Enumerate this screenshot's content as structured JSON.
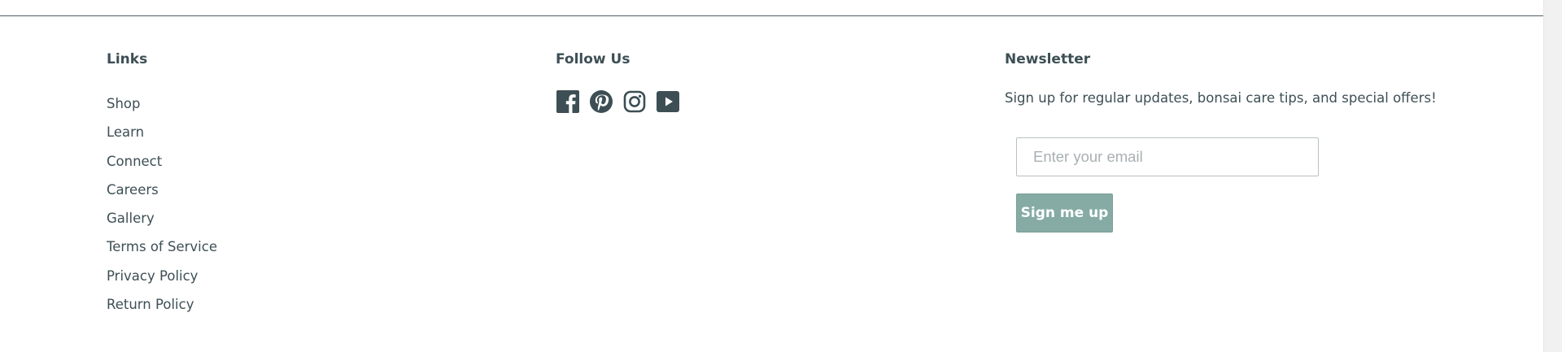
{
  "footer": {
    "links": {
      "title": "Links",
      "items": [
        {
          "label": "Shop"
        },
        {
          "label": "Learn"
        },
        {
          "label": "Connect"
        },
        {
          "label": "Careers"
        },
        {
          "label": "Gallery"
        },
        {
          "label": "Terms of Service"
        },
        {
          "label": "Privacy Policy"
        },
        {
          "label": "Return Policy"
        }
      ]
    },
    "follow": {
      "title": "Follow Us",
      "icons": [
        "facebook-icon",
        "pinterest-icon",
        "instagram-icon",
        "youtube-icon"
      ],
      "icon_color": "#3d4f55"
    },
    "newsletter": {
      "title": "Newsletter",
      "text": "Sign up for regular updates, bonsai care tips, and special offers!",
      "email_placeholder": "Enter your email",
      "email_value": "",
      "button_label": "Sign me up",
      "button_color": "#85aba4"
    }
  },
  "colors": {
    "text": "#3d4f55",
    "rule": "#4e6068"
  }
}
